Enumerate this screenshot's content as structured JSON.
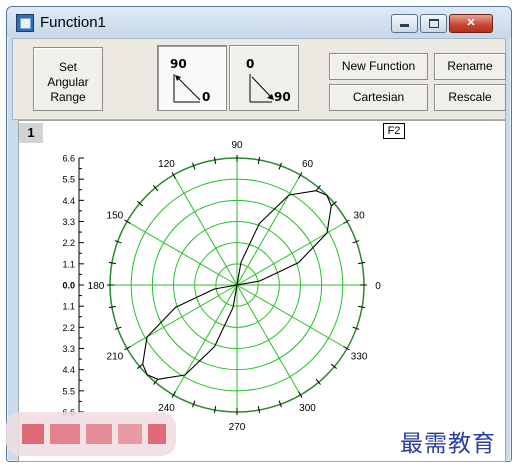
{
  "window": {
    "title": "Function1",
    "controls": {
      "minimize": "minimize",
      "maximize": "maximize",
      "close": "✕"
    }
  },
  "toolbar": {
    "set_angular_range": [
      "Set",
      "Angular",
      "Range"
    ],
    "direction_ccw": {
      "top": "90",
      "right": "0"
    },
    "direction_cw": {
      "top": "0",
      "right": "90"
    },
    "new_function": "New Function",
    "cartesian": "Cartesian",
    "rename": "Rename",
    "rescale": "Rescale"
  },
  "plot": {
    "layer_number": "1",
    "legend_label": "F2"
  },
  "chart_data": {
    "type": "line",
    "subtype": "polar",
    "angle_ticks": [
      "0",
      "30",
      "60",
      "90",
      "120",
      "150",
      "180",
      "210",
      "240",
      "270",
      "300",
      "330"
    ],
    "radial_axis_labels": [
      "6.6",
      "5.5",
      "4.4",
      "3.3",
      "2.2",
      "1.1",
      "0.0",
      "1.1",
      "2.2",
      "3.3",
      "4.4",
      "5.5",
      "6.6"
    ],
    "radial_range": [
      0,
      6.6
    ],
    "grid": true,
    "grid_color": "#26c026",
    "curve_color": "#000000",
    "series": [
      {
        "function": "r = 6.6*|sin(2θ)|^1.6 on lobes at 45° and 225°",
        "points_polar": [
          [
            0,
            0
          ],
          [
            10,
            1.2
          ],
          [
            20,
            3.4
          ],
          [
            30,
            5.4
          ],
          [
            40,
            6.4
          ],
          [
            45,
            6.6
          ],
          [
            50,
            6.4
          ],
          [
            60,
            5.4
          ],
          [
            70,
            3.4
          ],
          [
            80,
            1.2
          ],
          [
            90,
            0
          ],
          [
            180,
            0
          ],
          [
            190,
            1.2
          ],
          [
            200,
            3.4
          ],
          [
            210,
            5.4
          ],
          [
            220,
            6.4
          ],
          [
            225,
            6.6
          ],
          [
            230,
            6.4
          ],
          [
            240,
            5.4
          ],
          [
            250,
            3.4
          ],
          [
            260,
            1.2
          ],
          [
            270,
            0
          ]
        ]
      }
    ]
  },
  "watermark": {
    "text": "最需教育"
  },
  "colors": {
    "accent": "#26c026",
    "window_frame": "#c9dced",
    "close_red": "#c7442f"
  }
}
